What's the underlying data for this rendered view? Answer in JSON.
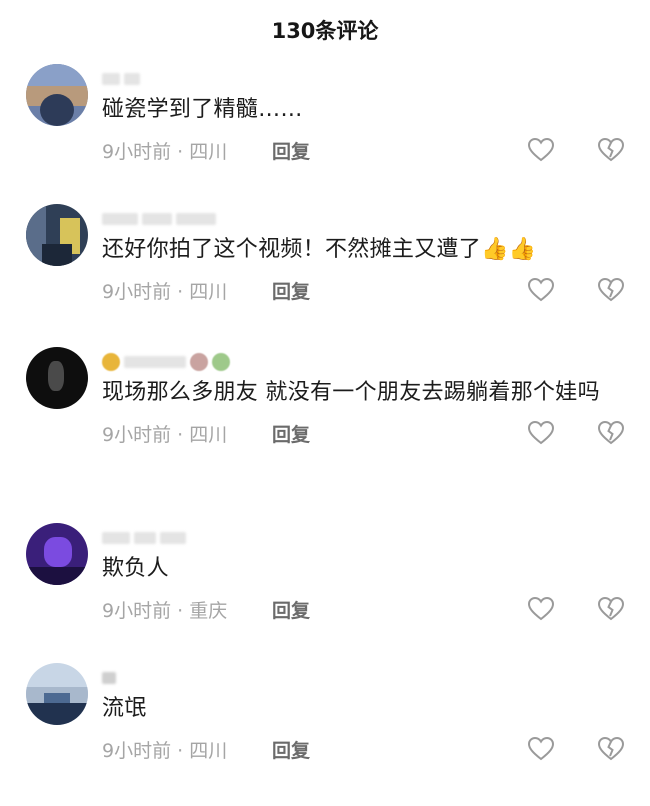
{
  "header": {
    "title": "130条评论"
  },
  "comments": [
    {
      "text": "碰瓷学到了精髓……",
      "time": "9小时前",
      "location": "四川",
      "reply_label": "回复",
      "avatar_colors": [
        "#6b7fa8",
        "#2d3b58",
        "#b89a7c"
      ]
    },
    {
      "text": "还好你拍了这个视频！不然摊主又遭了",
      "thumbs": "👍👍",
      "time": "9小时前",
      "location": "四川",
      "reply_label": "回复",
      "avatar_colors": [
        "#2f3f56",
        "#d7c35a",
        "#7d8fa8"
      ]
    },
    {
      "text": "现场那么多朋友   就没有一个朋友去踢躺着那个娃吗",
      "time": "9小时前",
      "location": "四川",
      "reply_label": "回复",
      "avatar_colors": [
        "#0e0e0e",
        "#4a4a4a",
        "#202020"
      ]
    },
    {
      "text": "欺负人",
      "time": "9小时前",
      "location": "重庆",
      "reply_label": "回复",
      "avatar_colors": [
        "#3a1f7a",
        "#7b4be0",
        "#1c1040"
      ]
    },
    {
      "text": "流氓",
      "time": "9小时前",
      "location": "四川",
      "reply_label": "回复",
      "avatar_colors": [
        "#c8d6e6",
        "#4d6a92",
        "#21324f"
      ]
    }
  ]
}
